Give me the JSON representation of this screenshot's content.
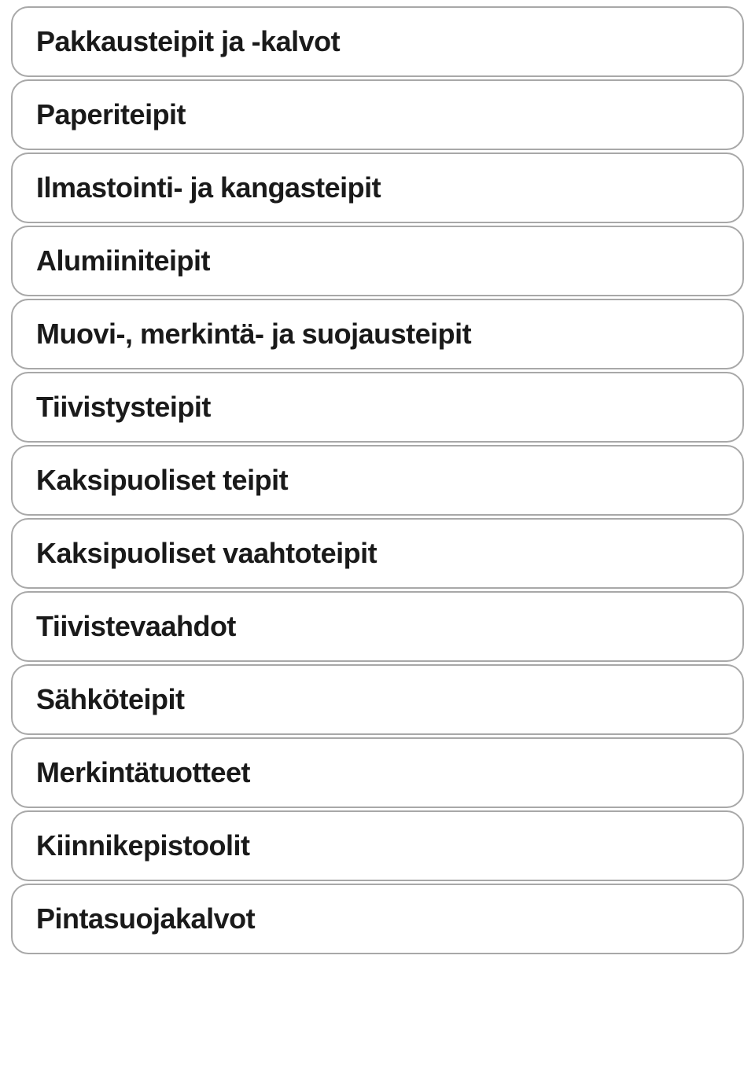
{
  "categories": [
    {
      "label": "Pakkausteipit ja -kalvot"
    },
    {
      "label": "Paperiteipit"
    },
    {
      "label": "Ilmastointi- ja kangasteipit"
    },
    {
      "label": "Alumiiniteipit"
    },
    {
      "label": "Muovi-, merkintä- ja suojausteipit"
    },
    {
      "label": "Tiivistysteipit"
    },
    {
      "label": "Kaksipuoliset teipit"
    },
    {
      "label": "Kaksipuoliset vaahtoteipit"
    },
    {
      "label": "Tiivistevaahdot"
    },
    {
      "label": "Sähköteipit"
    },
    {
      "label": "Merkintätuotteet"
    },
    {
      "label": "Kiinnikepistoolit"
    },
    {
      "label": "Pintasuojakalvot"
    }
  ]
}
